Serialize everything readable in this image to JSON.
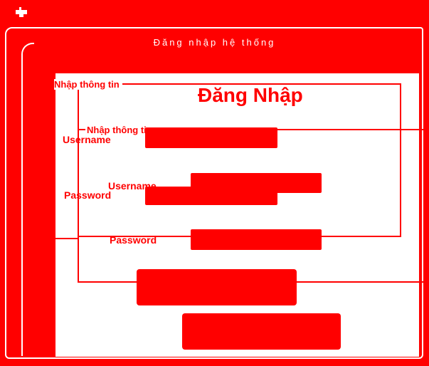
{
  "window": {
    "title": "Đăng nhập hệ thống"
  },
  "group_outer": {
    "label": "Nhập thông tin"
  },
  "group_inner": {
    "label": "Nhập thông tin"
  },
  "form": {
    "heading": "Đăng Nhập",
    "username_label_outer": "Username",
    "password_label_outer": "Password",
    "username_label_inner": "Username",
    "password_label_inner": "Password",
    "username_value": "",
    "password_value": "",
    "login_button": "",
    "exit_button": ""
  },
  "colors": {
    "accent": "#ff0000",
    "background": "#ffffff"
  }
}
